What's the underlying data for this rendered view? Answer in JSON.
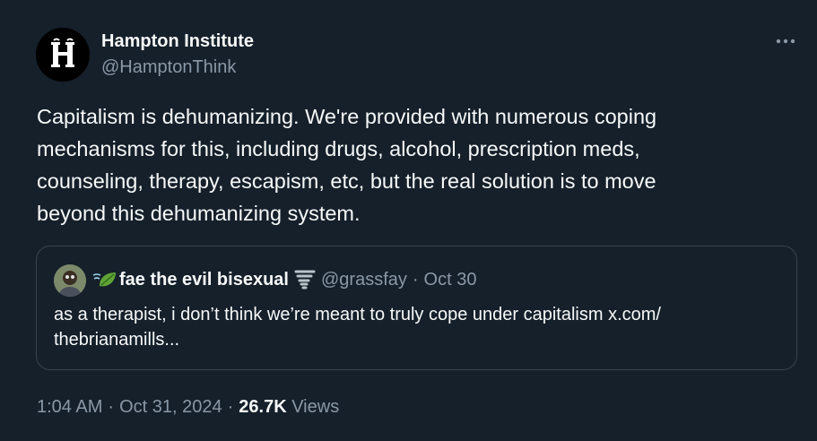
{
  "author": {
    "display_name": "Hampton Institute",
    "handle": "@HamptonThink",
    "avatar_icon": "hampton-logo-icon"
  },
  "menu": {
    "icon": "more-options-icon"
  },
  "tweet": {
    "text": "Capitalism is dehumanizing. We're provided with numerous coping\nmechanisms for this, including drugs, alcohol, prescription meds,\ncounseling, therapy, escapism, etc, but the real solution is to move\nbeyond this dehumanizing system."
  },
  "quote": {
    "display_name": "fae the evil bisexual",
    "name_prefix_icon": "leaf-fluttering-in-wind-icon",
    "name_suffix_icon": "tornado-icon",
    "handle": "@grassfay",
    "separator": "·",
    "date": "Oct 30",
    "text_line1": "as a therapist, i don’t think we’re meant to truly cope under capitalism x.com/",
    "text_line2": "thebrianamills..."
  },
  "meta": {
    "time": "1:04 AM",
    "separator1": "·",
    "date": "Oct 31, 2024",
    "separator2": "·",
    "views_count": "26.7K",
    "views_label": "Views"
  },
  "colors": {
    "background": "#15202b",
    "primary_text": "#f7f9f9",
    "secondary_text": "#8b98a5",
    "border": "#38444d"
  }
}
